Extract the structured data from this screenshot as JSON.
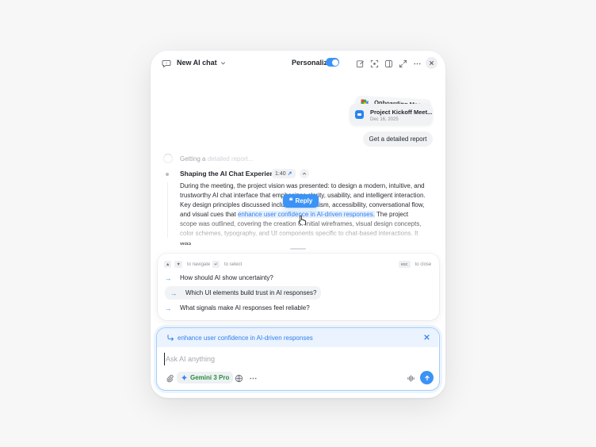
{
  "header": {
    "title": "New AI chat",
    "personalize_label": "Personalize",
    "personalize_on": true,
    "icons": [
      "chat-bubble-icon",
      "chevron-down-icon",
      "edit-icon",
      "focus-icon",
      "sidebar-icon",
      "expand-icon",
      "more-icon",
      "close-icon"
    ]
  },
  "conversation": {
    "attachments": [
      {
        "title": "Onboarding Mee..."
      },
      {
        "title": "Project Kickoff Meet...",
        "date": "Dec 16, 2025"
      }
    ],
    "user_message": "Get a detailed report",
    "status": {
      "prefix": "Getting a",
      "faded": " detailed report..."
    },
    "section": {
      "title": "Shaping the AI Chat Experience",
      "timestamp": "1:40",
      "text_before": "During the meeting, the project vision was presented: to design a modern, intuitive, and trustworthy AI chat interface that emphasizes clarity, usability, and intelligent interaction. Key design principles discussed included minimalism, accessibility, conversational flow, and visual cues that ",
      "highlight": "enhance user confidence in AI-driven responses.",
      "text_after": " The project scope was outlined, covering the creation of initial wireframes, visual design concepts, color schemes, typography, and UI components specific to chat-based interactions. It was"
    },
    "reply_label": "Reply"
  },
  "suggestions": {
    "hints": {
      "navigate": "to navigate",
      "select": "to select",
      "close_key": "esc",
      "close": "to close"
    },
    "items": [
      {
        "label": "How should AI show uncertainty?"
      },
      {
        "label": "Which UI elements build trust in AI responses?"
      },
      {
        "label": "What signals make AI responses feel reliable?"
      }
    ],
    "active_index": 1
  },
  "composer": {
    "quote": "enhance user confidence in AI-driven responses",
    "placeholder": "Ask AI anything",
    "model": "Gemini 3 Pro"
  },
  "colors": {
    "accent": "#3b93f5",
    "highlight_bg": "#e6f0fd",
    "model_text": "#2b8a3e"
  }
}
